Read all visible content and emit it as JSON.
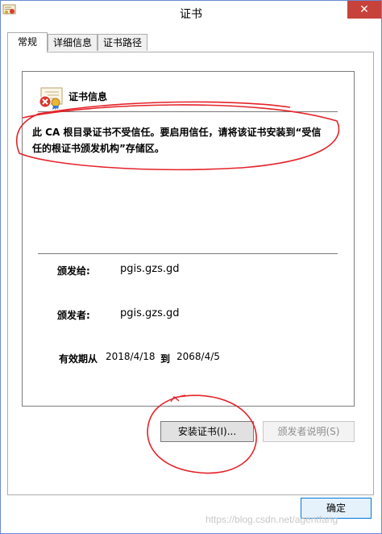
{
  "window": {
    "title": "证书"
  },
  "tabs": [
    {
      "label": "常规",
      "active": true
    },
    {
      "label": "详细信息",
      "active": false
    },
    {
      "label": "证书路径",
      "active": false
    }
  ],
  "certificate": {
    "heading": "证书信息",
    "warning_line1": "此 CA 根目录证书不受信任。要启用信任，请将该证书安装到“受信",
    "warning_line2": "任的根证书颁发机构”存储区。",
    "issued_to_label": "颁发给:",
    "issued_to_value": "pgis.gzs.gd",
    "issued_by_label": "颁发者:",
    "issued_by_value": "pgis.gzs.gd",
    "valid_label": "有效期从",
    "valid_from": "2018/4/18",
    "valid_until_label": "到",
    "valid_until": "2068/4/5"
  },
  "buttons": {
    "install": "安装证书(I)...",
    "issuer_statement": "颁发者说明(S)",
    "ok": "确定"
  },
  "watermark": "https://blog.csdn.net/agentfang",
  "colors": {
    "close_button": "#c7423a",
    "annotation": "#e4242b",
    "ok_button_border": "#0078d7"
  },
  "icons": {
    "app": "certificate-icon",
    "certificate": "certificate-error-icon",
    "close": "close-icon"
  }
}
